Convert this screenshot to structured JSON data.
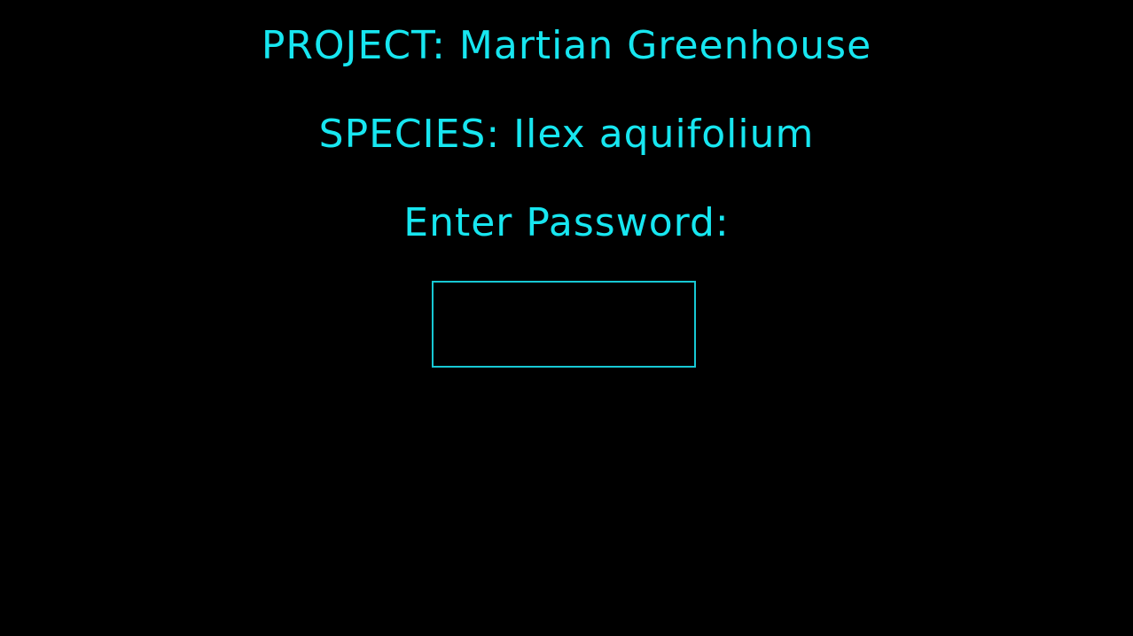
{
  "screen": {
    "project_text": "PROJECT: Martian Greenhouse",
    "species_text": "SPECIES: Ilex aquifolium",
    "prompt_text": "Enter Password:",
    "password": {
      "value": "",
      "placeholder": ""
    }
  },
  "colors": {
    "background": "#000000",
    "text": "#17e6f0",
    "input_border": "#17c8d4"
  }
}
